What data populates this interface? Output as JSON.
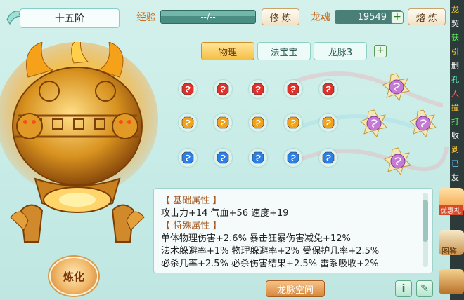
{
  "header": {
    "tier": "十五阶",
    "exp_label": "经验",
    "exp_value": "--/--",
    "cultivate_btn": "修 炼",
    "soul_label": "龙魂",
    "soul_value": "19549",
    "smelt_btn": "熔 炼"
  },
  "tabs": [
    {
      "label": "物理",
      "active": true
    },
    {
      "label": "法宝宝",
      "active": false
    },
    {
      "label": "龙脉3",
      "active": false
    }
  ],
  "gems": {
    "rows": [
      {
        "color": "#e0302a",
        "count": 5
      },
      {
        "color": "#f2a21a",
        "count": 5
      },
      {
        "color": "#2c7fe6",
        "count": 5
      }
    ]
  },
  "info": {
    "base_header": "【 基础属性 】",
    "base_line": "攻击力+14  气血+56  速度+19",
    "special_header": "【 特殊属性 】",
    "lines": [
      "单体物理伤害+2.6%  暴击狂暴伤害减免+12%",
      "法术躲避率+1%  物理躲避率+2%  受保护几率+2.5%",
      "必杀几率+2.5%  必杀伤害结果+2.5%  雷系吸收+2%"
    ]
  },
  "refine_btn": "炼化",
  "space_btn": "龙脉空间",
  "side": {
    "gift": "优惠礼",
    "guide": "图鉴"
  },
  "strip_chars": [
    "龙",
    "契",
    "获",
    "引",
    "删",
    "孔",
    "人",
    "撞",
    "打",
    "收",
    "到",
    "已",
    "友"
  ]
}
